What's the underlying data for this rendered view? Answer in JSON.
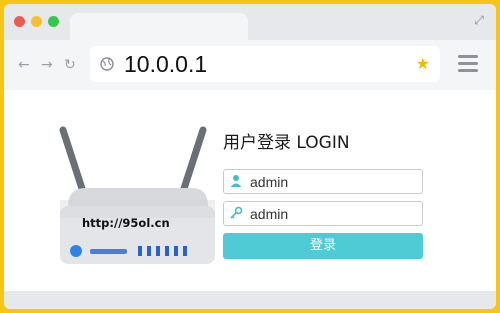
{
  "browser": {
    "url": "10.0.0.1",
    "nav": {
      "back": "←",
      "forward": "→",
      "reload": "↻"
    },
    "bookmark_icon": "star-icon",
    "menu_icon": "hamburger-menu-icon"
  },
  "router_label": "http://95ol.cn",
  "login": {
    "title": "用户登录 LOGIN",
    "username": "admin",
    "password": "admin",
    "button": "登录"
  },
  "colors": {
    "frame": "#f7c515",
    "button": "#4ecbd4",
    "accent_icon": "#3fc1cb",
    "router_led": "#2f83e6"
  }
}
